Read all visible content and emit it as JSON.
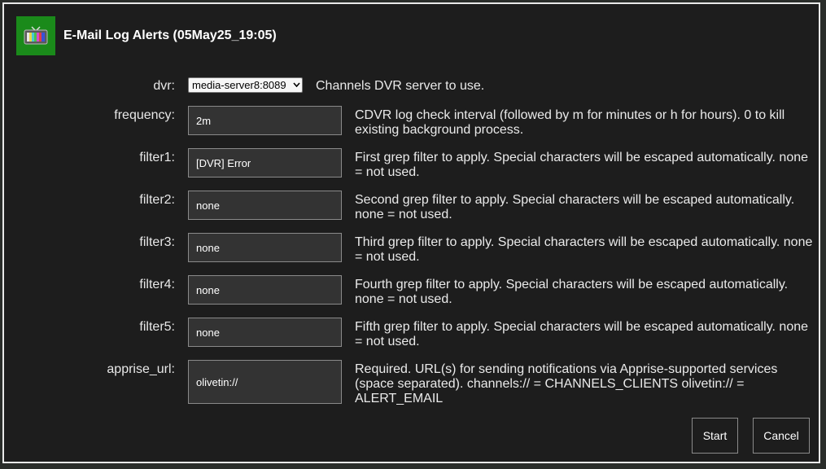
{
  "dialog": {
    "title": "E-Mail Log Alerts (05May25_19:05)"
  },
  "fields": {
    "dvr": {
      "label": "dvr:",
      "value": "media-server8:8089",
      "help": "Channels DVR server to use."
    },
    "frequency": {
      "label": "frequency:",
      "value": "2m",
      "help": "CDVR log check interval (followed by m for minutes or h for hours). 0 to kill existing background process."
    },
    "filter1": {
      "label": "filter1:",
      "value": "[DVR] Error",
      "help": "First grep filter to apply. Special characters will be escaped automatically. none = not used."
    },
    "filter2": {
      "label": "filter2:",
      "value": "none",
      "help": "Second grep filter to apply. Special characters will be escaped automatically. none = not used."
    },
    "filter3": {
      "label": "filter3:",
      "value": "none",
      "help": "Third grep filter to apply. Special characters will be escaped automatically. none = not used."
    },
    "filter4": {
      "label": "filter4:",
      "value": "none",
      "help": "Fourth grep filter to apply. Special characters will be escaped automatically. none = not used."
    },
    "filter5": {
      "label": "filter5:",
      "value": "none",
      "help": "Fifth grep filter to apply. Special characters will be escaped automatically. none = not used."
    },
    "apprise_url": {
      "label": "apprise_url:",
      "value": "olivetin://",
      "help": "Required. URL(s) for sending notifications via Apprise-supported services (space separated). channels:// = CHANNELS_CLIENTS olivetin:// = ALERT_EMAIL"
    }
  },
  "buttons": {
    "start": "Start",
    "cancel": "Cancel"
  },
  "icon": "tv-icon",
  "colors": {
    "accent": "#1a8a1a",
    "background": "#1d1d1d"
  }
}
